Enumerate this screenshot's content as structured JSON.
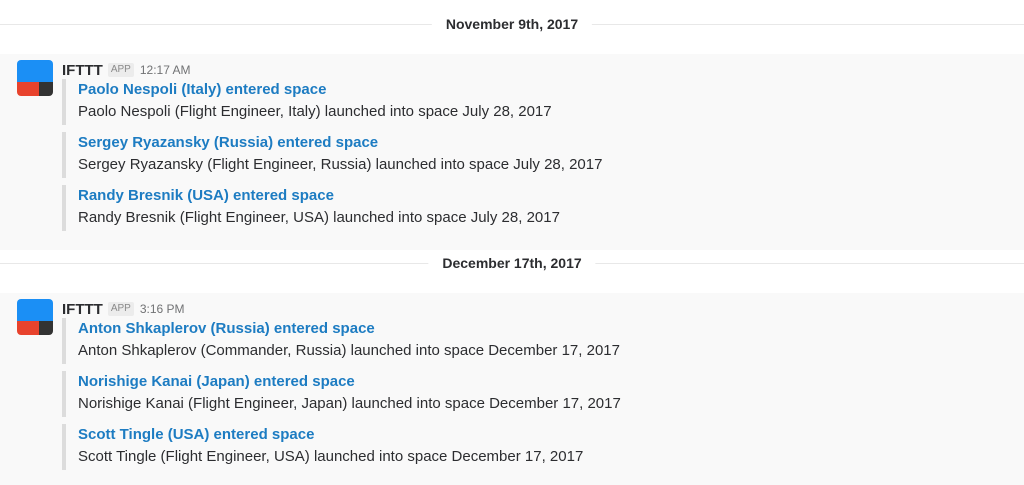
{
  "days": [
    {
      "date": "November 9th, 2017",
      "message": {
        "sender": "IFTTT",
        "badge": "APP",
        "time": "12:17 AM",
        "attachments": [
          {
            "title": "Paolo Nespoli (Italy) entered space",
            "text": "Paolo Nespoli (Flight Engineer, Italy) launched into space July 28, 2017"
          },
          {
            "title": "Sergey Ryazansky (Russia) entered space",
            "text": "Sergey Ryazansky (Flight Engineer, Russia) launched into space July 28, 2017"
          },
          {
            "title": "Randy Bresnik (USA) entered space",
            "text": "Randy Bresnik (Flight Engineer, USA) launched into space July 28, 2017"
          }
        ]
      }
    },
    {
      "date": "December 17th, 2017",
      "message": {
        "sender": "IFTTT",
        "badge": "APP",
        "time": "3:16 PM",
        "attachments": [
          {
            "title": "Anton Shkaplerov (Russia) entered space",
            "text": "Anton Shkaplerov (Commander, Russia) launched into space December 17, 2017"
          },
          {
            "title": "Norishige Kanai (Japan) entered space",
            "text": "Norishige Kanai (Flight Engineer, Japan) launched into space December 17, 2017"
          },
          {
            "title": "Scott Tingle (USA) entered space",
            "text": "Scott Tingle (Flight Engineer, USA) launched into space December 17, 2017"
          }
        ]
      }
    }
  ],
  "colors": {
    "link": "#1d7cc2",
    "avatar_blue": "#1b8ff5",
    "avatar_red": "#e8432d",
    "avatar_dark": "#333333"
  },
  "icons": {
    "avatar": "ifttt-logo-icon"
  }
}
